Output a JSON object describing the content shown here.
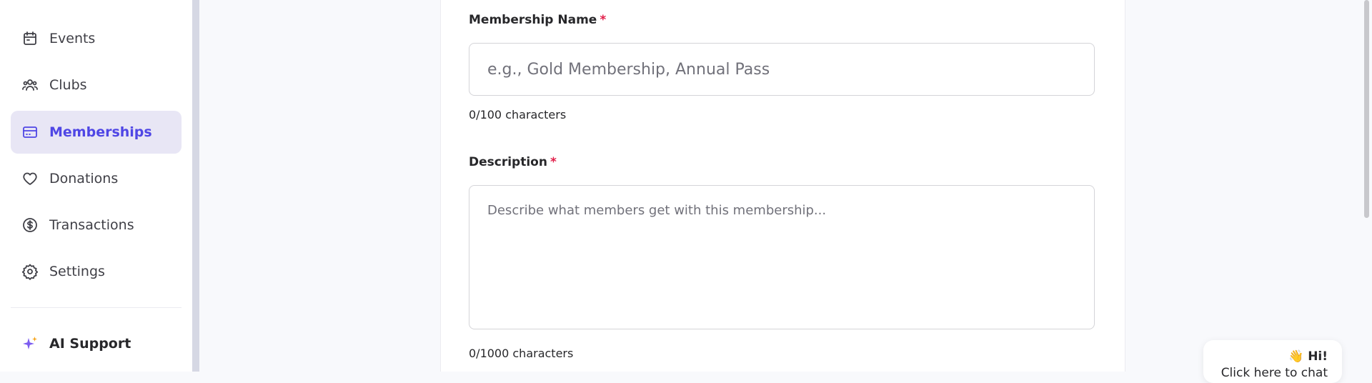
{
  "sidebar": {
    "items": [
      {
        "label": "Events",
        "icon": "calendar-icon",
        "active": false
      },
      {
        "label": "Clubs",
        "icon": "users-icon",
        "active": false
      },
      {
        "label": "Memberships",
        "icon": "credit-card-icon",
        "active": true
      },
      {
        "label": "Donations",
        "icon": "heart-icon",
        "active": false
      },
      {
        "label": "Transactions",
        "icon": "dollar-circle-icon",
        "active": false
      },
      {
        "label": "Settings",
        "icon": "gear-icon",
        "active": false
      }
    ],
    "ai_support": {
      "label": "AI Support",
      "icon": "sparkle-icon"
    }
  },
  "form": {
    "name_field": {
      "label": "Membership Name",
      "required_mark": "*",
      "value": "",
      "placeholder": "e.g., Gold Membership, Annual Pass",
      "counter": "0/100 characters"
    },
    "description_field": {
      "label": "Description",
      "required_mark": "*",
      "value": "",
      "placeholder": "Describe what members get with this membership...",
      "counter": "0/1000 characters"
    }
  },
  "chat_widget": {
    "emoji": "👋",
    "greeting": "Hi!",
    "subtext": "Click here to chat"
  },
  "colors": {
    "accent": "#4f46e5",
    "active_bg": "#e8e6f5",
    "required": "#e11d48",
    "sparkle": "#7c5cf0"
  }
}
